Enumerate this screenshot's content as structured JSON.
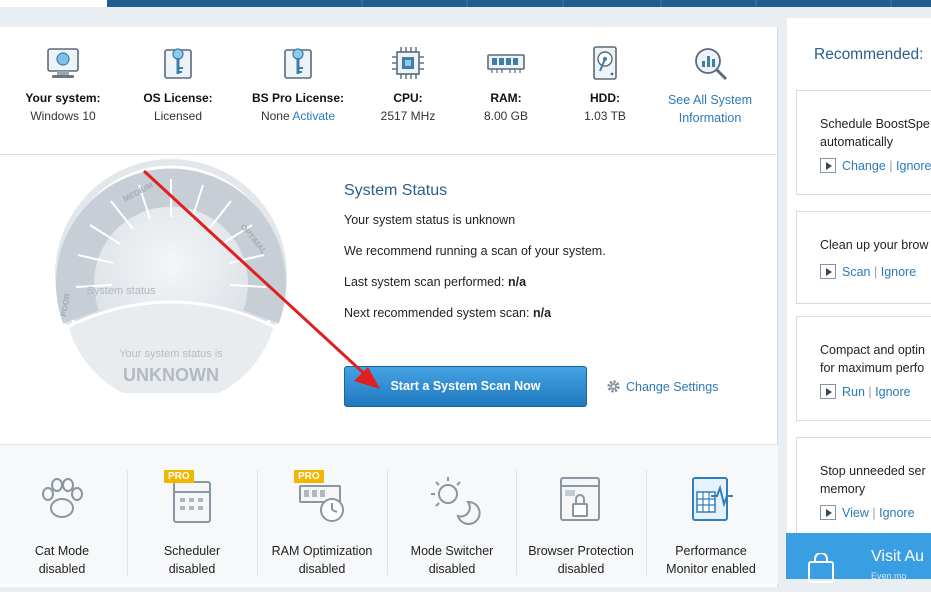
{
  "system": {
    "items": [
      {
        "label": "Your system:",
        "value": "Windows 10",
        "icon": "monitor-icon"
      },
      {
        "label": "OS License:",
        "value": "Licensed",
        "icon": "key-icon"
      },
      {
        "label": "BS Pro License:",
        "value": "None",
        "action": "Activate",
        "icon": "key-icon"
      },
      {
        "label": "CPU:",
        "value": "2517 MHz",
        "icon": "cpu-icon"
      },
      {
        "label": "RAM:",
        "value": "8.00 GB",
        "icon": "ram-icon"
      },
      {
        "label": "HDD:",
        "value": "1.03 TB",
        "icon": "hdd-icon"
      }
    ],
    "see_all": "See All System Information"
  },
  "gauge": {
    "medium": "MEDIUM",
    "optimal": "OPTIMAL",
    "poor": "POOR",
    "system_status": "System status",
    "status_is": "Your system status is",
    "status_value": "UNKNOWN"
  },
  "status": {
    "title": "System Status",
    "line1": "Your system status is unknown",
    "line2": "We recommend running a scan of your system.",
    "last_scan_label": "Last system scan performed:",
    "last_scan_value": "n/a",
    "next_scan_label": "Next recommended system scan:",
    "next_scan_value": "n/a",
    "scan_button": "Start a System Scan Now",
    "change_settings": "Change Settings"
  },
  "tools": [
    {
      "name": "Cat Mode",
      "state": "disabled",
      "pro": false,
      "icon": "paw-icon"
    },
    {
      "name": "Scheduler",
      "state": "disabled",
      "pro": true,
      "icon": "calendar-icon"
    },
    {
      "name": "RAM Optimization",
      "state": "disabled",
      "pro": true,
      "icon": "ram-clock-icon"
    },
    {
      "name": "Mode Switcher",
      "state": "disabled",
      "pro": false,
      "icon": "sun-moon-icon"
    },
    {
      "name": "Browser Protection",
      "state": "disabled",
      "pro": false,
      "icon": "browser-lock-icon"
    },
    {
      "name": "Performance",
      "state": "Monitor enabled",
      "pro": false,
      "icon": "performance-icon"
    }
  ],
  "pro_badge": "PRO",
  "recommended": {
    "title": "Recommended:",
    "cards": [
      {
        "text1": "Schedule BoostSpe",
        "text2": "automatically",
        "a1": "Change",
        "a2": "Ignore"
      },
      {
        "text1": "Clean up your brow",
        "text2": "",
        "a1": "Scan",
        "a2": "Ignore"
      },
      {
        "text1": "Compact and optin",
        "text2": "for maximum perfo",
        "a1": "Run",
        "a2": "Ignore"
      },
      {
        "text1": "Stop unneeded ser",
        "text2": "memory",
        "a1": "View",
        "a2": "Ignore"
      }
    ],
    "separator": "|"
  },
  "visit": {
    "title": "Visit Au",
    "sub": "Even mo"
  },
  "colors": {
    "accent": "#2a7ab8",
    "button": "#2d8bd3",
    "topbar": "#1e5d8e",
    "pro": "#f2b500"
  }
}
